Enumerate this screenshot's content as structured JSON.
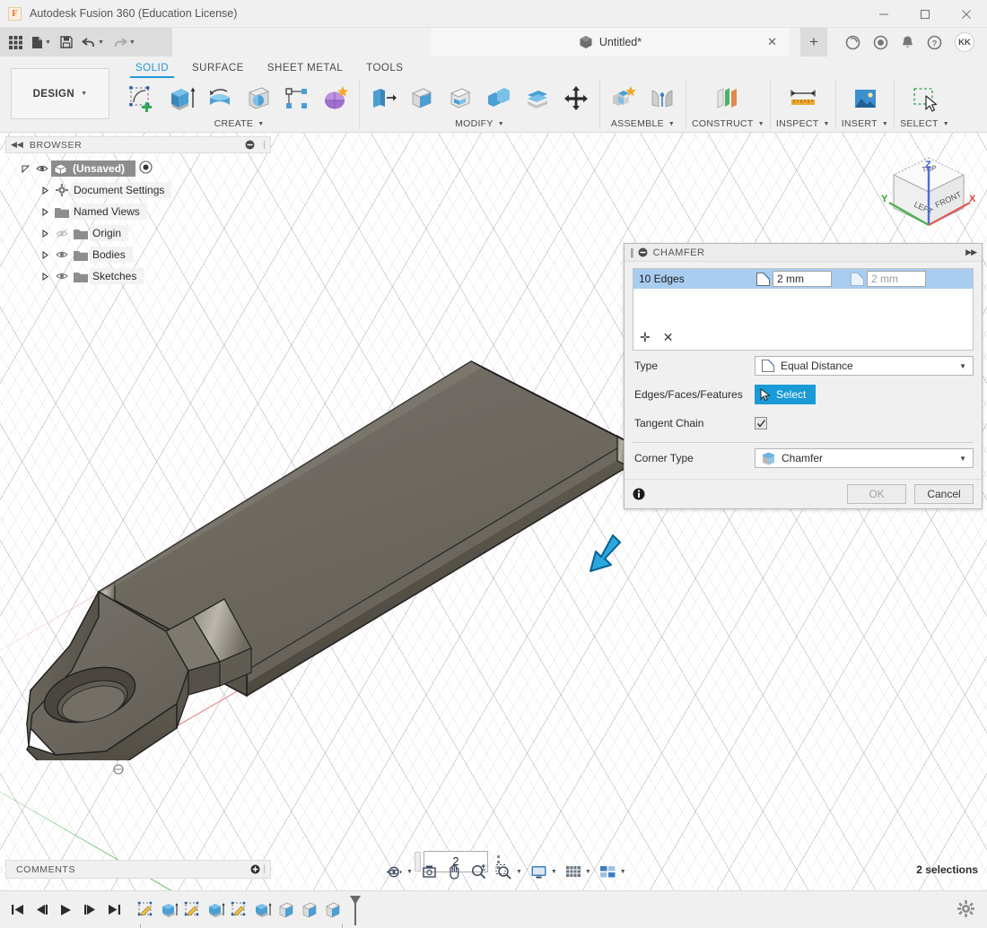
{
  "window": {
    "app_title": "Autodesk Fusion 360 (Education License)",
    "logo_letter": "F",
    "minimize": "—",
    "maximize": "▢",
    "close": "✕"
  },
  "quick_access": {
    "items": [
      {
        "name": "grid-apps-icon",
        "label": ""
      },
      {
        "name": "new-file-icon",
        "label": ""
      },
      {
        "name": "save-icon",
        "label": ""
      },
      {
        "name": "undo-icon",
        "label": ""
      },
      {
        "name": "redo-icon",
        "label": ""
      }
    ]
  },
  "tabs": {
    "document": {
      "title": "Untitled*",
      "close_label": "✕"
    },
    "new_tab_label": "+",
    "right_icons": [
      {
        "name": "job-status-icon"
      },
      {
        "name": "recent-activity-icon"
      },
      {
        "name": "notifications-bell-icon"
      },
      {
        "name": "help-icon"
      }
    ],
    "avatar_initials": "KK"
  },
  "ribbon": {
    "workspace": "DESIGN",
    "tabs": [
      {
        "label": "SOLID",
        "active": true
      },
      {
        "label": "SURFACE",
        "active": false
      },
      {
        "label": "SHEET METAL",
        "active": false
      },
      {
        "label": "TOOLS",
        "active": false
      }
    ],
    "panels": [
      {
        "label": "CREATE",
        "has_dropdown": true,
        "tools": [
          "create-sketch-icon",
          "extrude-icon",
          "revolve-icon",
          "sweep-icon",
          "pattern-icon",
          "form-icon"
        ]
      },
      {
        "label": "MODIFY",
        "has_dropdown": true,
        "tools": [
          "press-pull-icon",
          "fillet-icon",
          "shell-icon",
          "combine-icon",
          "offset-face-icon",
          "move-copy-icon"
        ]
      },
      {
        "label": "ASSEMBLE",
        "has_dropdown": true,
        "tools": [
          "new-component-icon",
          "joint-icon"
        ]
      },
      {
        "label": "CONSTRUCT",
        "has_dropdown": true,
        "tools": [
          "offset-plane-icon"
        ]
      },
      {
        "label": "INSPECT",
        "has_dropdown": true,
        "tools": [
          "measure-icon"
        ]
      },
      {
        "label": "INSERT",
        "has_dropdown": true,
        "tools": [
          "insert-image-icon"
        ]
      },
      {
        "label": "SELECT",
        "has_dropdown": true,
        "tools": [
          "select-window-icon"
        ]
      }
    ]
  },
  "browser": {
    "title": "BROWSER",
    "collapse_icon": "◀◀",
    "settings_icon": "⊖",
    "root": {
      "label": "(Unsaved)",
      "visible": true
    },
    "items": [
      {
        "label": "Document Settings",
        "icon": "gear-icon",
        "has_eye": false
      },
      {
        "label": "Named Views",
        "icon": "folder-icon",
        "has_eye": false
      },
      {
        "label": "Origin",
        "icon": "folder-icon",
        "has_eye": true,
        "eye_off": true
      },
      {
        "label": "Bodies",
        "icon": "folder-icon",
        "has_eye": true,
        "eye_off": false
      },
      {
        "label": "Sketches",
        "icon": "folder-icon",
        "has_eye": true,
        "eye_off": false
      }
    ]
  },
  "chamfer_dialog": {
    "title": "CHAMFER",
    "collapse_icon": "⊖",
    "expand_icon": "▶▶",
    "edge_rows": [
      {
        "name": "10 Edges",
        "distance_1": "2 mm",
        "distance_2": "2 mm",
        "selected": true
      }
    ],
    "list_add_label": "✛",
    "list_remove_label": "✕",
    "fields": [
      {
        "label": "Type",
        "value": "Equal Distance",
        "control": "dropdown"
      },
      {
        "label": "Edges/Faces/Features",
        "value": "Select",
        "control": "select-button"
      },
      {
        "label": "Tangent Chain",
        "value": "✓",
        "control": "checkbox",
        "checked": true
      },
      {
        "label": "Corner Type",
        "value": "Chamfer",
        "control": "dropdown"
      }
    ],
    "info_icon": "ⓘ",
    "ok_label": "OK",
    "ok_enabled": false,
    "cancel_label": "Cancel"
  },
  "canvas": {
    "input_value": "2",
    "manipulator": "chamfer-arrow",
    "viewcube": {
      "faces": [
        "TOP",
        "LEFT",
        "FRONT"
      ],
      "axes": [
        {
          "label": "X",
          "color": "#e25a5a"
        },
        {
          "label": "Y",
          "color": "#4eb24e"
        },
        {
          "label": "Z",
          "color": "#4a6ed8"
        }
      ]
    },
    "model_color": "#6a665d"
  },
  "comments": {
    "title": "COMMENTS",
    "add_icon": "⊕"
  },
  "navbar": {
    "items": [
      {
        "name": "orbit-icon",
        "dropdown": true
      },
      {
        "name": "look-at-icon",
        "dropdown": false
      },
      {
        "name": "pan-icon",
        "dropdown": false
      },
      {
        "name": "zoom-icon",
        "dropdown": false
      },
      {
        "name": "zoom-window-icon",
        "dropdown": true
      },
      {
        "name": "display-settings-icon",
        "dropdown": true
      },
      {
        "name": "grid-snaps-icon",
        "dropdown": true
      },
      {
        "name": "viewports-icon",
        "dropdown": true
      }
    ]
  },
  "status": {
    "selection_text": "2 selections"
  },
  "timeline": {
    "controls": [
      {
        "name": "jump-start-button",
        "glyph": "|◀"
      },
      {
        "name": "step-back-button",
        "glyph": "◀|"
      },
      {
        "name": "play-button",
        "glyph": "▶"
      },
      {
        "name": "step-forward-button",
        "glyph": "|▶"
      },
      {
        "name": "jump-end-button",
        "glyph": "▶|"
      }
    ],
    "features": [
      {
        "name": "sketch-feature",
        "type": "sketch"
      },
      {
        "name": "extrude-feature",
        "type": "extrude"
      },
      {
        "name": "sketch-feature",
        "type": "sketch"
      },
      {
        "name": "extrude-feature",
        "type": "extrude"
      },
      {
        "name": "sketch-feature",
        "type": "sketch"
      },
      {
        "name": "extrude-feature",
        "type": "extrude"
      },
      {
        "name": "fillet-feature",
        "type": "fillet"
      },
      {
        "name": "fillet-feature",
        "type": "fillet"
      },
      {
        "name": "fillet-feature",
        "type": "fillet"
      }
    ],
    "settings_icon": "gear-icon"
  }
}
